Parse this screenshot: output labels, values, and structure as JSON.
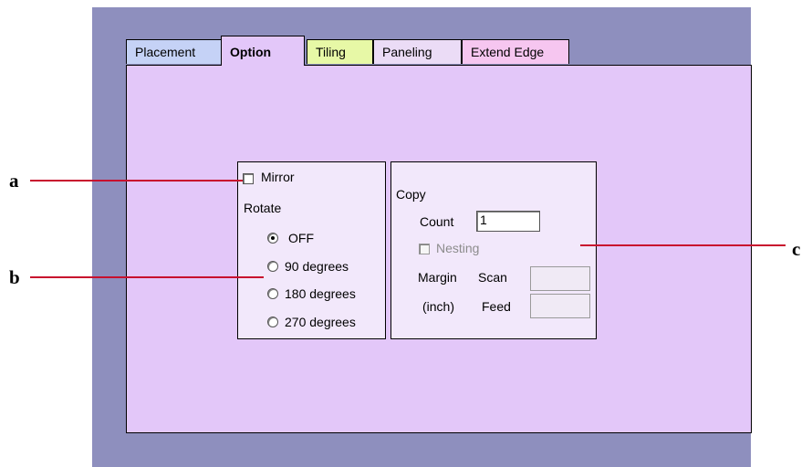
{
  "tabs": [
    {
      "label": "Placement",
      "color": "#c5d2f6",
      "active": false
    },
    {
      "label": "Option",
      "color": "#e3c7f9",
      "active": true
    },
    {
      "label": "Tiling",
      "color": "#e7f8a6",
      "active": false
    },
    {
      "label": "Paneling",
      "color": "#ebdcf6",
      "active": false
    },
    {
      "label": "Extend Edge",
      "color": "#f6c6f0",
      "active": false
    }
  ],
  "mirror": {
    "label": "Mirror",
    "checked": false
  },
  "rotate": {
    "label": "Rotate",
    "options": [
      {
        "label": "OFF",
        "selected": true
      },
      {
        "label": "90 degrees",
        "selected": false
      },
      {
        "label": "180 degrees",
        "selected": false
      },
      {
        "label": "270 degrees",
        "selected": false
      }
    ]
  },
  "copy": {
    "label": "Copy",
    "count_label": "Count",
    "count_value": "1",
    "nesting_label": "Nesting",
    "margin_label": "Margin",
    "unit_label": "(inch)",
    "scan_label": "Scan",
    "feed_label": "Feed",
    "scan_value": "",
    "feed_value": ""
  },
  "callouts": {
    "a": "a",
    "b": "b",
    "c": "c"
  },
  "colors": {
    "background": "#8e8fbe",
    "panel": "#e3c7f9",
    "group": "#f2e8fb",
    "callout_line": "#c8102e"
  }
}
